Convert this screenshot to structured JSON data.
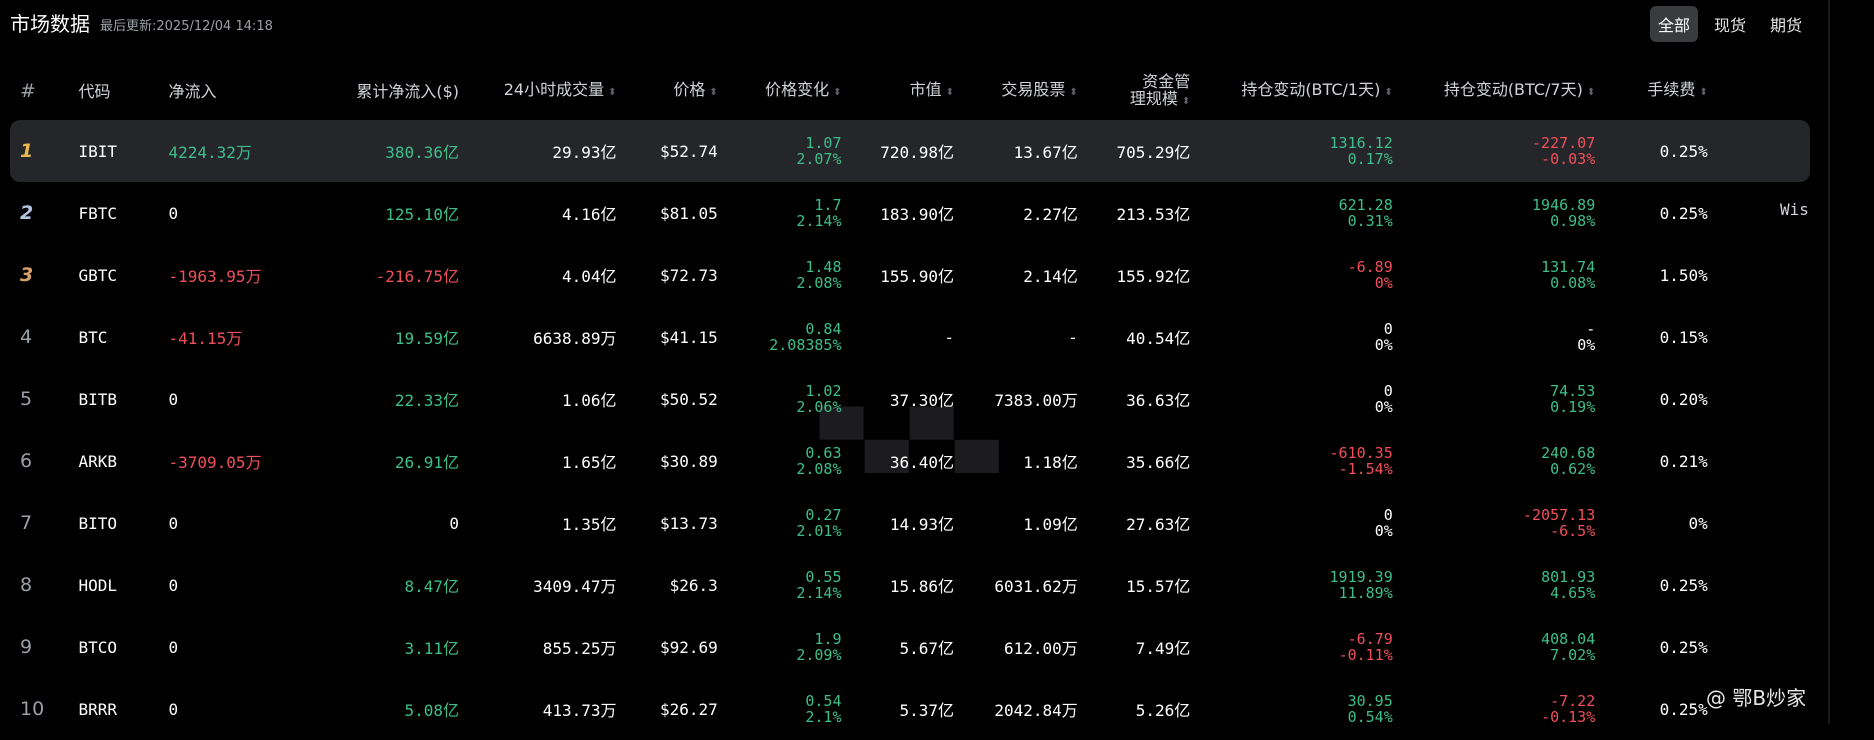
{
  "header": {
    "title": "市场数据",
    "updated": "最后更新:2025/12/04 14:18",
    "filters": [
      {
        "label": "全部",
        "active": true
      },
      {
        "label": "现货",
        "active": false
      },
      {
        "label": "期货",
        "active": false
      }
    ]
  },
  "table": {
    "headers": {
      "rank": "#",
      "code": "代码",
      "netflow": "净流入",
      "cum_netflow": "累计净流入($)",
      "volume": "24小时成交量",
      "price": "价格",
      "price_change": "价格变化",
      "mcap": "市值",
      "shares": "交易股票",
      "aum_line1": "资金管",
      "aum_line2": "理规模",
      "hold1d": "持仓变动(BTC/1天)",
      "hold7d": "持仓变动(BTC/7天)",
      "fee": "手续费"
    },
    "rows": [
      {
        "rank": "1",
        "code": "IBIT",
        "netflow": "4224.32万",
        "netflow_color": "green",
        "cum": "380.36亿",
        "cum_color": "green",
        "volume": "29.93亿",
        "price": "$52.74",
        "chg": "1.07",
        "chg_pct": "2.07%",
        "mcap": "720.98亿",
        "shares": "13.67亿",
        "aum": "705.29亿",
        "h1": "1316.12",
        "h1_pct": "0.17%",
        "h1_color": "green",
        "h7": "-227.07",
        "h7_pct": "-0.03%",
        "h7_color": "red",
        "fee": "0.25%"
      },
      {
        "rank": "2",
        "code": "FBTC",
        "netflow": "0",
        "netflow_color": "white",
        "cum": "125.10亿",
        "cum_color": "green",
        "volume": "4.16亿",
        "price": "$81.05",
        "chg": "1.7",
        "chg_pct": "2.14%",
        "mcap": "183.90亿",
        "shares": "2.27亿",
        "aum": "213.53亿",
        "h1": "621.28",
        "h1_pct": "0.31%",
        "h1_color": "green",
        "h7": "1946.89",
        "h7_pct": "0.98%",
        "h7_color": "green",
        "fee": "0.25%"
      },
      {
        "rank": "3",
        "code": "GBTC",
        "netflow": "-1963.95万",
        "netflow_color": "red",
        "cum": "-216.75亿",
        "cum_color": "red",
        "volume": "4.04亿",
        "price": "$72.73",
        "chg": "1.48",
        "chg_pct": "2.08%",
        "mcap": "155.90亿",
        "shares": "2.14亿",
        "aum": "155.92亿",
        "h1": "-6.89",
        "h1_pct": "0%",
        "h1_color": "red",
        "h7": "131.74",
        "h7_pct": "0.08%",
        "h7_color": "green",
        "fee": "1.50%"
      },
      {
        "rank": "4",
        "code": "BTC",
        "netflow": "-41.15万",
        "netflow_color": "red",
        "cum": "19.59亿",
        "cum_color": "green",
        "volume": "6638.89万",
        "price": "$41.15",
        "chg": "0.84",
        "chg_pct": "2.08385%",
        "mcap": "-",
        "shares": "-",
        "aum": "40.54亿",
        "h1": "0",
        "h1_pct": "0%",
        "h1_color": "white",
        "h7": "-",
        "h7_pct": "0%",
        "h7_color": "white",
        "fee": "0.15%"
      },
      {
        "rank": "5",
        "code": "BITB",
        "netflow": "0",
        "netflow_color": "white",
        "cum": "22.33亿",
        "cum_color": "green",
        "volume": "1.06亿",
        "price": "$50.52",
        "chg": "1.02",
        "chg_pct": "2.06%",
        "mcap": "37.30亿",
        "shares": "7383.00万",
        "aum": "36.63亿",
        "h1": "0",
        "h1_pct": "0%",
        "h1_color": "white",
        "h7": "74.53",
        "h7_pct": "0.19%",
        "h7_color": "green",
        "fee": "0.20%"
      },
      {
        "rank": "6",
        "code": "ARKB",
        "netflow": "-3709.05万",
        "netflow_color": "red",
        "cum": "26.91亿",
        "cum_color": "green",
        "volume": "1.65亿",
        "price": "$30.89",
        "chg": "0.63",
        "chg_pct": "2.08%",
        "mcap": "36.40亿",
        "shares": "1.18亿",
        "aum": "35.66亿",
        "h1": "-610.35",
        "h1_pct": "-1.54%",
        "h1_color": "red",
        "h7": "240.68",
        "h7_pct": "0.62%",
        "h7_color": "green",
        "fee": "0.21%"
      },
      {
        "rank": "7",
        "code": "BITO",
        "netflow": "0",
        "netflow_color": "white",
        "cum": "0",
        "cum_color": "white",
        "volume": "1.35亿",
        "price": "$13.73",
        "chg": "0.27",
        "chg_pct": "2.01%",
        "mcap": "14.93亿",
        "shares": "1.09亿",
        "aum": "27.63亿",
        "h1": "0",
        "h1_pct": "0%",
        "h1_color": "white",
        "h7": "-2057.13",
        "h7_pct": "-6.5%",
        "h7_color": "red",
        "fee": "0%"
      },
      {
        "rank": "8",
        "code": "HODL",
        "netflow": "0",
        "netflow_color": "white",
        "cum": "8.47亿",
        "cum_color": "green",
        "volume": "3409.47万",
        "price": "$26.3",
        "chg": "0.55",
        "chg_pct": "2.14%",
        "mcap": "15.86亿",
        "shares": "6031.62万",
        "aum": "15.57亿",
        "h1": "1919.39",
        "h1_pct": "11.89%",
        "h1_color": "green",
        "h7": "801.93",
        "h7_pct": "4.65%",
        "h7_color": "green",
        "fee": "0.25%"
      },
      {
        "rank": "9",
        "code": "BTCO",
        "netflow": "0",
        "netflow_color": "white",
        "cum": "3.11亿",
        "cum_color": "green",
        "volume": "855.25万",
        "price": "$92.69",
        "chg": "1.9",
        "chg_pct": "2.09%",
        "mcap": "5.67亿",
        "shares": "612.00万",
        "aum": "7.49亿",
        "h1": "-6.79",
        "h1_pct": "-0.11%",
        "h1_color": "red",
        "h7": "408.04",
        "h7_pct": "7.02%",
        "h7_color": "green",
        "fee": "0.25%"
      },
      {
        "rank": "10",
        "code": "BRRR",
        "netflow": "0",
        "netflow_color": "white",
        "cum": "5.08亿",
        "cum_color": "green",
        "volume": "413.73万",
        "price": "$26.27",
        "chg": "0.54",
        "chg_pct": "2.1%",
        "mcap": "5.37亿",
        "shares": "2042.84万",
        "aum": "5.26亿",
        "h1": "30.95",
        "h1_pct": "0.54%",
        "h1_color": "green",
        "h7": "-7.22",
        "h7_pct": "-0.13%",
        "h7_color": "red",
        "fee": "0.25%"
      }
    ]
  },
  "overflow_text": "Wis",
  "watermark": "@ 鄂B炒家",
  "colors": {
    "green": "#3ebf8a",
    "red": "#f0505b",
    "bg": "#000000",
    "highlight": "#25262a"
  }
}
